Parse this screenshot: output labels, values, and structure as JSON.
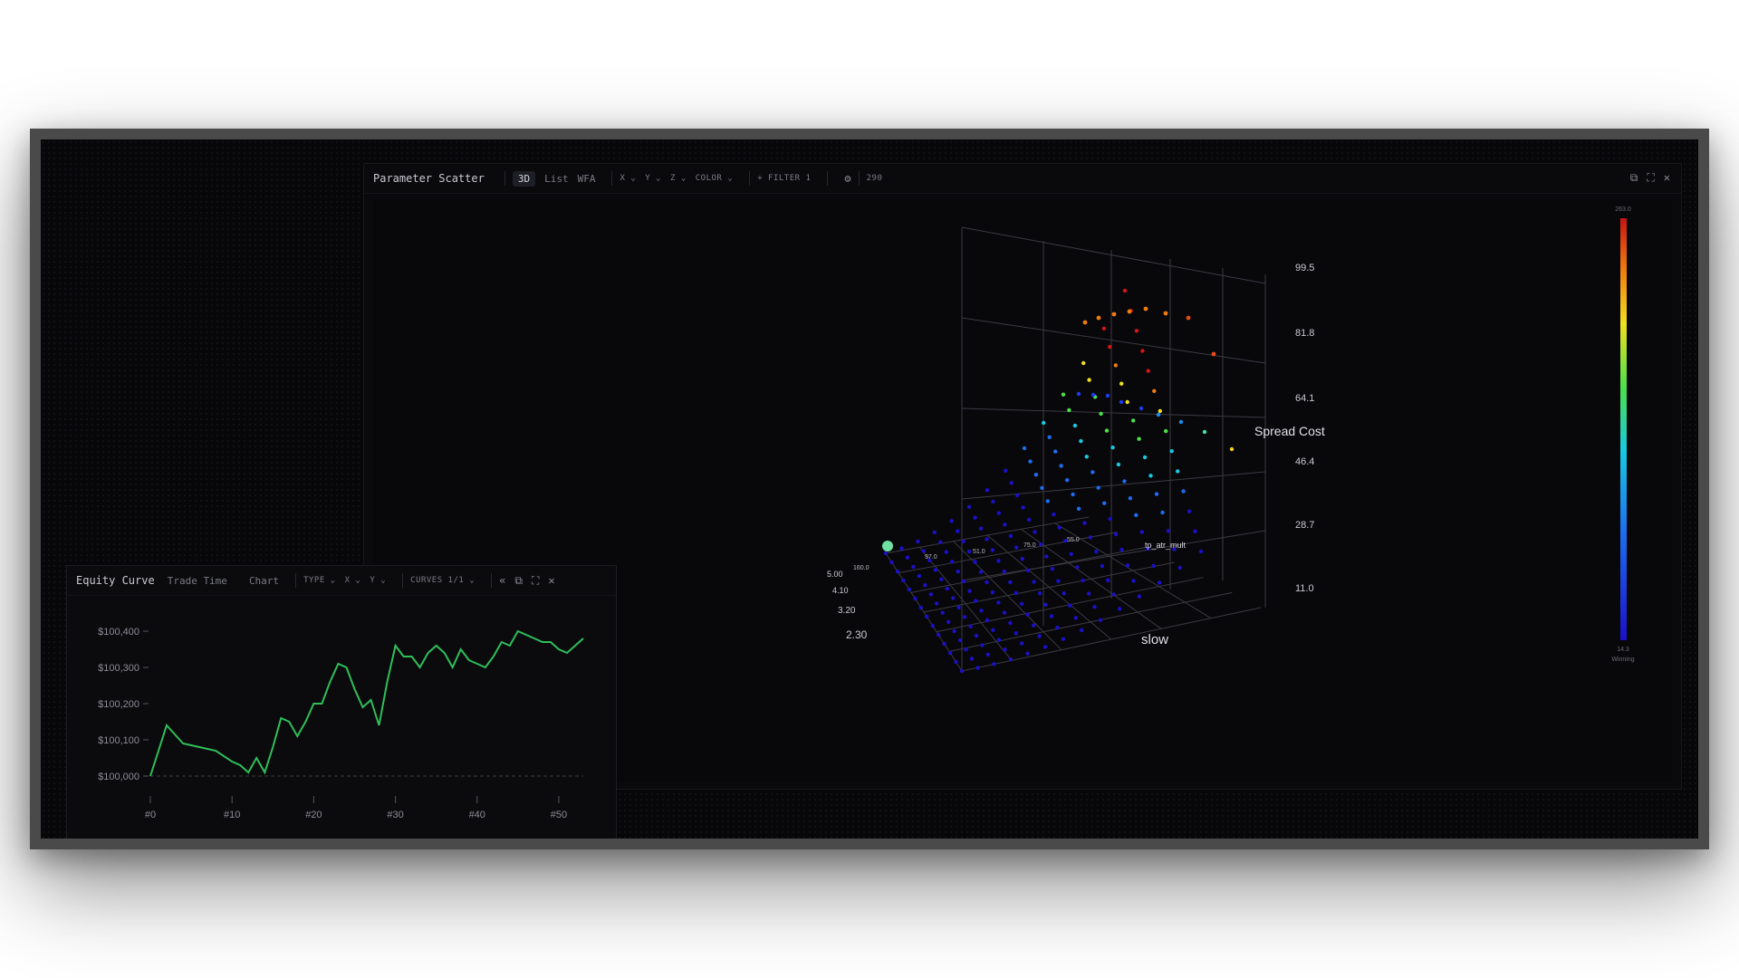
{
  "scatter": {
    "title": "Parameter Scatter",
    "tabs": [
      "3D",
      "List",
      "WFA"
    ],
    "dropdowns": [
      "X",
      "Y",
      "Z",
      "COLOR"
    ],
    "filter_label": "+ FILTER 1",
    "count": "290",
    "z_axis_title": "Spread Cost",
    "x_axis_title": "slow",
    "y_axis_inline": "tp_atr_mult",
    "z_ticks": [
      "99.5",
      "81.8",
      "64.1",
      "46.4",
      "28.7",
      "11.0"
    ],
    "y_ticks": [
      "5.00",
      "4.10",
      "3.20",
      "2.30"
    ],
    "floor_ticks": [
      "160.0",
      "97.0",
      "51.0",
      "75.0",
      "55.0"
    ],
    "colorbar_max": "263.0",
    "colorbar_min": "14.3",
    "colorbar_label": "Winning"
  },
  "equity": {
    "tabs": [
      "Equity Curve",
      "Trade Time",
      "Chart"
    ],
    "dropdowns": [
      "TYPE",
      "X",
      "Y"
    ],
    "curves_label": "CURVES 1/1",
    "collapse": "«",
    "accent": "#2fbf5a",
    "chart_data": {
      "type": "line",
      "x_ticks": [
        "#0",
        "#10",
        "#20",
        "#30",
        "#40",
        "#50"
      ],
      "y_ticks": [
        "$100,400",
        "$100,300",
        "$100,200",
        "$100,100",
        "$100,000"
      ],
      "ylim": [
        100000,
        100400
      ],
      "xlim": [
        0,
        53
      ],
      "series": [
        {
          "x": [
            0,
            2,
            4,
            6,
            8,
            10,
            11,
            12,
            13,
            14,
            15,
            16,
            17,
            18,
            19,
            20,
            21,
            22,
            23,
            24,
            25,
            26,
            27,
            28,
            29,
            30,
            31,
            32,
            33,
            34,
            35,
            36,
            37,
            38,
            39,
            40,
            41,
            42,
            43,
            44,
            45,
            46,
            47,
            48,
            49,
            50,
            51,
            52,
            53
          ],
          "values": [
            100000,
            100140,
            100090,
            100080,
            100070,
            100040,
            100030,
            100010,
            100050,
            100010,
            100080,
            100160,
            100150,
            100110,
            100150,
            100200,
            100200,
            100260,
            100310,
            100300,
            100240,
            100190,
            100210,
            100140,
            100260,
            100360,
            100330,
            100330,
            100300,
            100340,
            100360,
            100340,
            100300,
            100350,
            100320,
            100310,
            100300,
            100330,
            100370,
            100360,
            100400,
            100390,
            100380,
            100370,
            100370,
            100350,
            100340,
            100360,
            100380
          ]
        }
      ]
    }
  }
}
